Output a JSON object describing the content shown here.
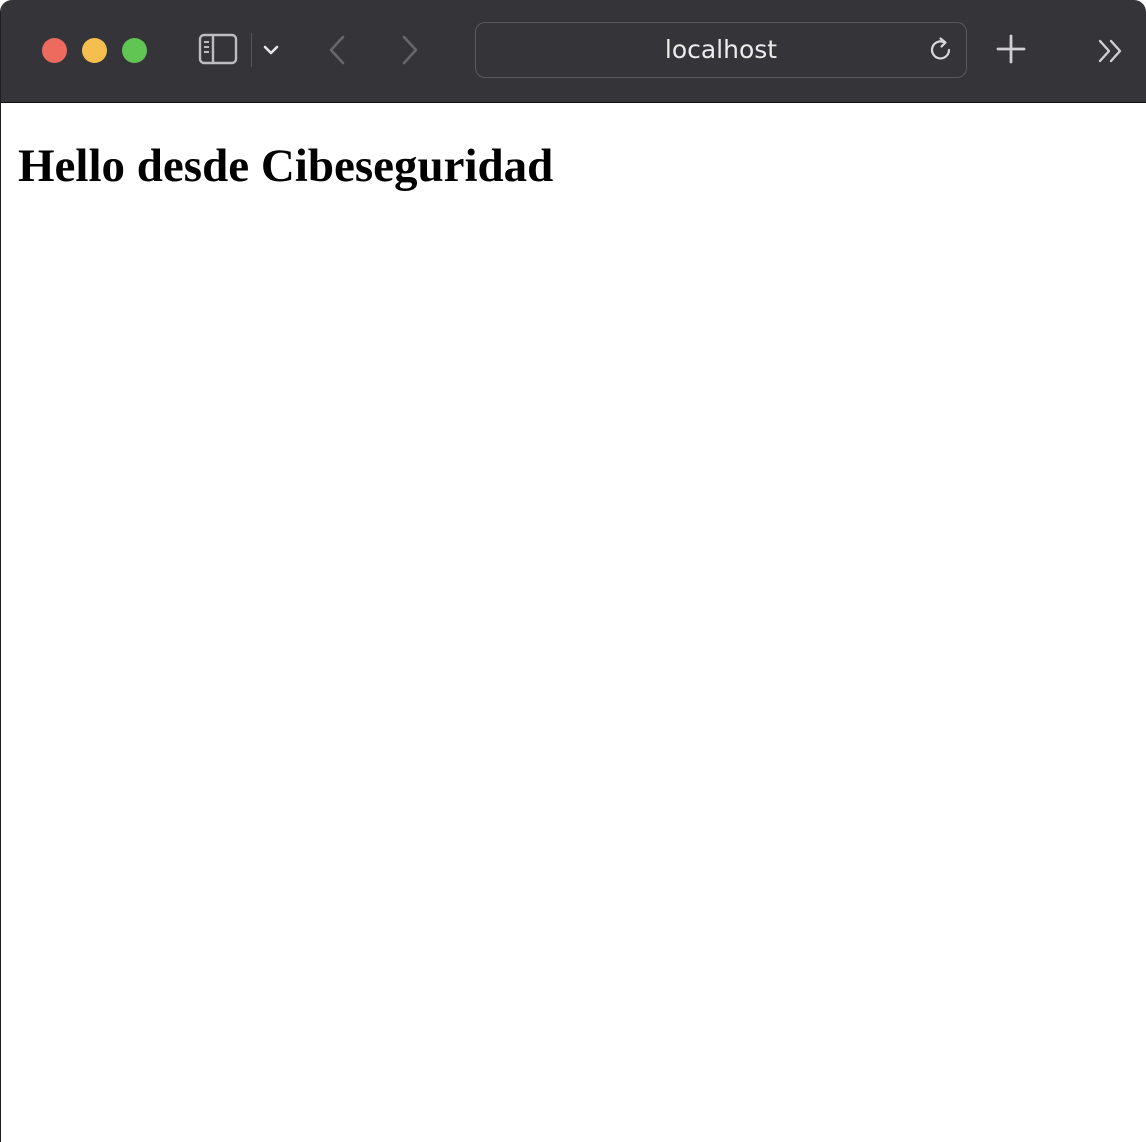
{
  "browser": {
    "address_bar": {
      "url": "localhost"
    },
    "icons": {
      "sidebar": "sidebar-icon",
      "tab_group_menu": "chevron-down-icon",
      "back": "chevron-left-icon",
      "forward": "chevron-right-icon",
      "reload": "reload-icon",
      "new_tab": "plus-icon",
      "overflow": "double-chevron-right-icon"
    },
    "colors": {
      "toolbar": "#353438",
      "close": "#ed6a5e",
      "minimize": "#f5bf4f",
      "maximize": "#61c554"
    }
  },
  "page": {
    "heading": "Hello desde Cibeseguridad"
  }
}
